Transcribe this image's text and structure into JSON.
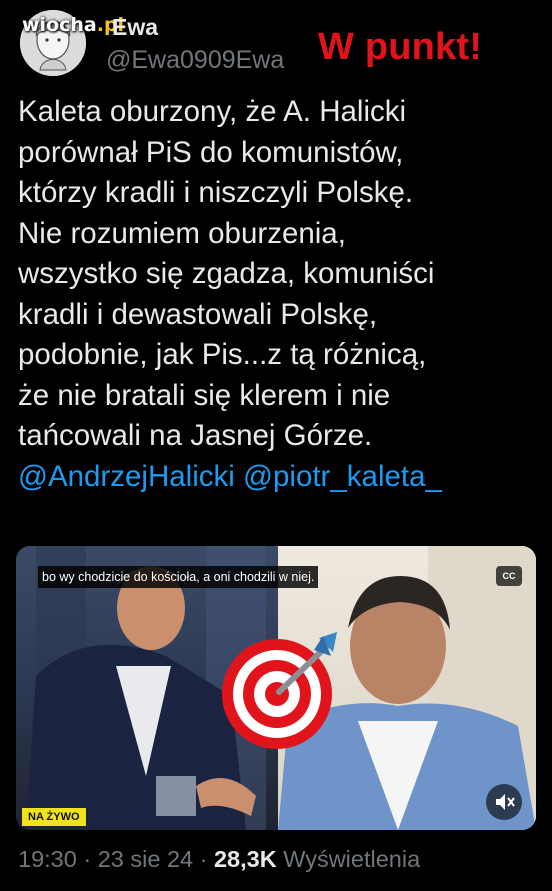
{
  "watermark": {
    "site": "wiocha",
    "tld": ".pl"
  },
  "author": {
    "name": "Ewa",
    "handle": "@Ewa0909Ewa"
  },
  "stamp": "W punkt!",
  "tweet": {
    "lines": [
      "Kaleta oburzony, że A. Halicki",
      "porównał PiS do komunistów,",
      "którzy kradli i niszczyli Polskę.",
      "Nie rozumiem oburzenia,",
      "wszystko się zgadza, komuniści",
      "kradli i dewastowali Polskę,",
      "podobnie, jak Pis...z tą różnicą,",
      "że nie bratali się klerem i nie",
      "tańcowali na Jasnej Górze."
    ],
    "mentions": [
      "@AndrzejHalicki",
      "@piotr_kaleta_"
    ]
  },
  "video": {
    "caption": "bo wy chodzicie do kościoła, a oni chodzili w niej.",
    "cc_label": "CC",
    "live_badge": "NA ŻYWO",
    "overlay_icon": "bullseye-target-icon",
    "mute_icon": "speaker-muted-icon"
  },
  "footer": {
    "time": "19:30",
    "date": "23 sie 24",
    "views_count": "28,3K",
    "views_label": "Wyświetlenia",
    "separator": "·"
  },
  "colors": {
    "background": "#000000",
    "text": "#e7e9ea",
    "muted": "#71767b",
    "mention": "#1d9bf0",
    "stamp": "#e3131b",
    "live_badge": "#f2e21c"
  }
}
